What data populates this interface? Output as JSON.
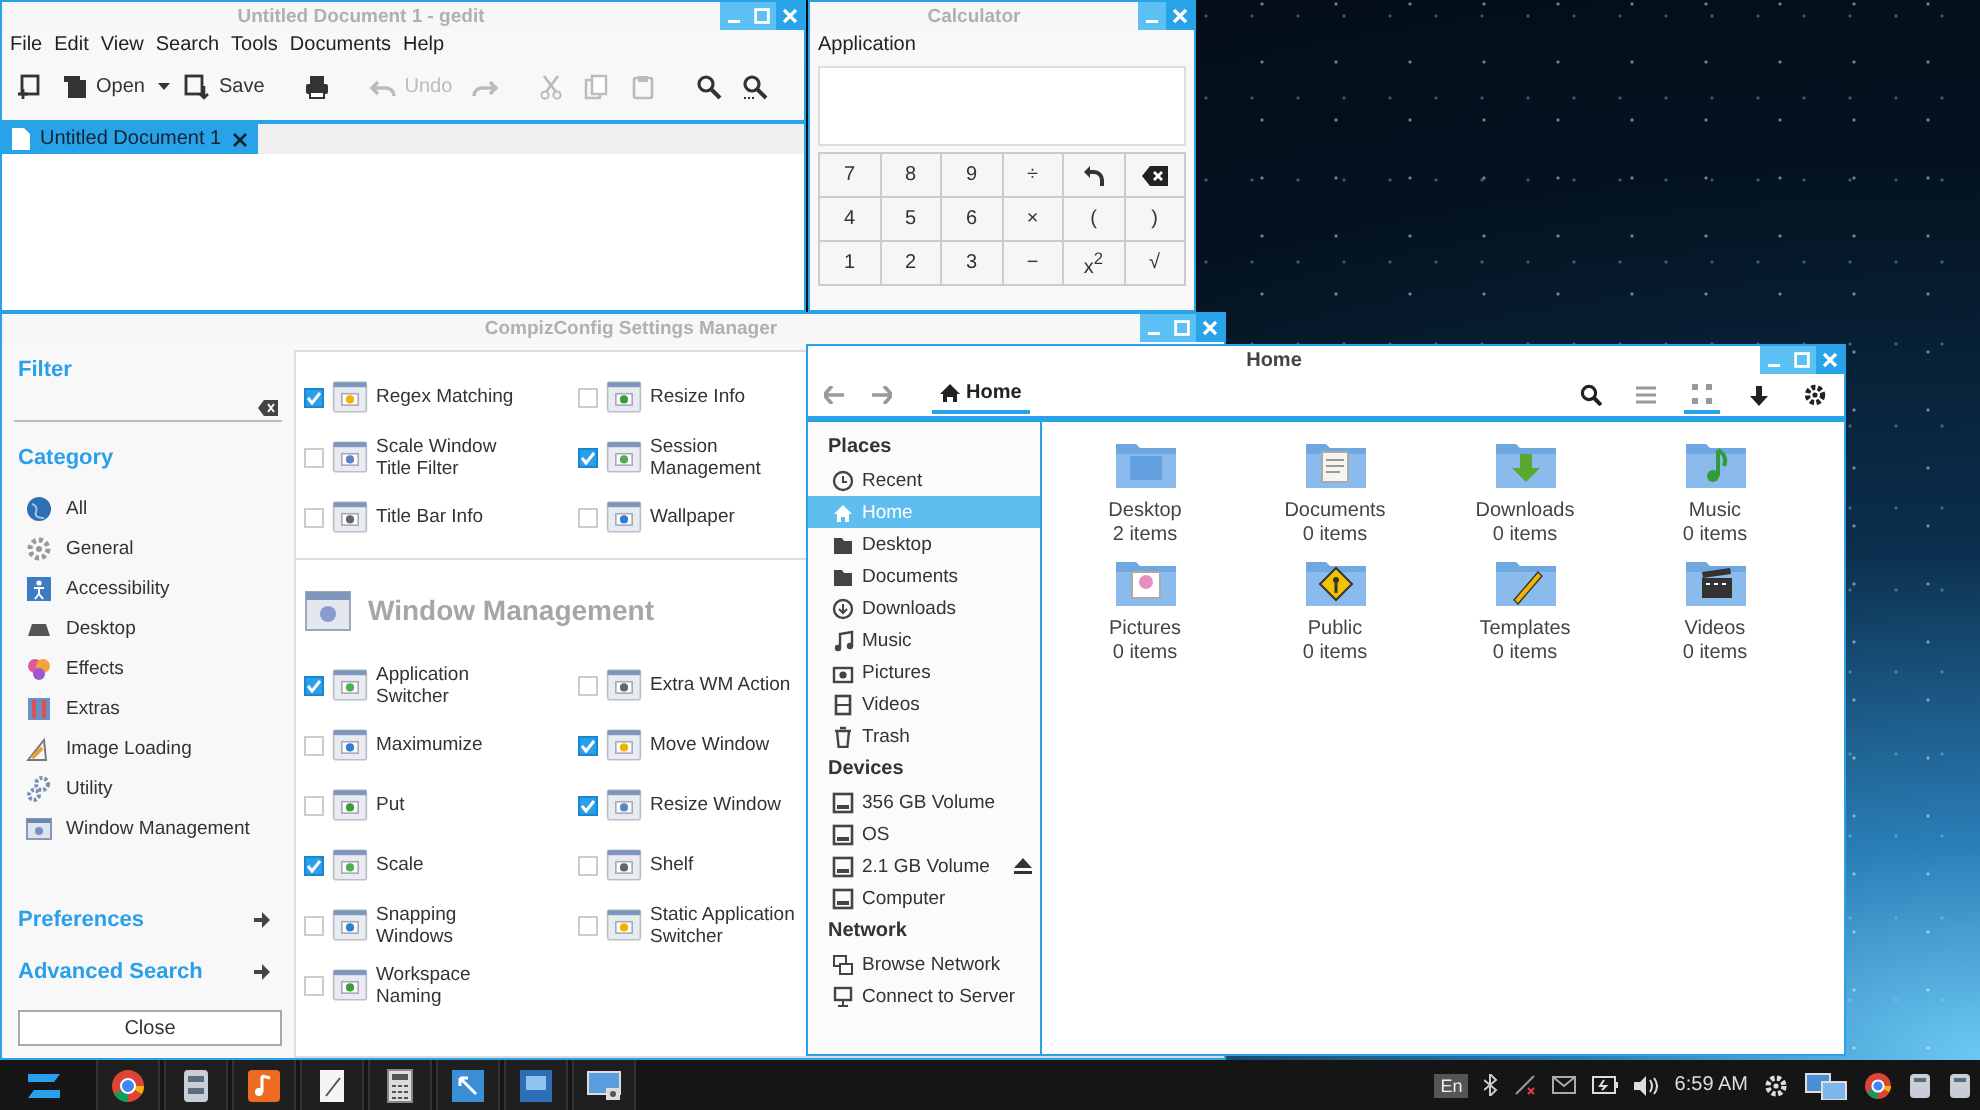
{
  "gedit": {
    "title": "Untitled Document 1 - gedit",
    "menu": [
      "File",
      "Edit",
      "View",
      "Search",
      "Tools",
      "Documents",
      "Help"
    ],
    "toolbar": [
      {
        "kind": "new",
        "disabled": false
      },
      {
        "kind": "open",
        "label": "Open",
        "disabled": false
      },
      {
        "kind": "save",
        "label": "Save",
        "disabled": false
      },
      {
        "kind": "print",
        "disabled": false
      },
      {
        "kind": "undo",
        "label": "Undo",
        "disabled": true
      },
      {
        "kind": "redo",
        "disabled": true
      },
      {
        "kind": "cut",
        "disabled": true
      },
      {
        "kind": "copy",
        "disabled": true
      },
      {
        "kind": "paste",
        "disabled": true
      },
      {
        "kind": "find",
        "disabled": false
      },
      {
        "kind": "replace",
        "disabled": false
      }
    ],
    "tabs": [
      {
        "label": "Untitled Document 1",
        "selected": true
      }
    ]
  },
  "calculator": {
    "title": "Calculator",
    "menu": [
      "Application"
    ],
    "keys": [
      [
        {
          "kind": "text",
          "label": "7"
        },
        {
          "kind": "text",
          "label": "8"
        },
        {
          "kind": "text",
          "label": "9"
        },
        {
          "kind": "text",
          "label": "÷"
        },
        {
          "kind": "undo"
        },
        {
          "kind": "backspace"
        }
      ],
      [
        {
          "kind": "text",
          "label": "4"
        },
        {
          "kind": "text",
          "label": "5"
        },
        {
          "kind": "text",
          "label": "6"
        },
        {
          "kind": "text",
          "label": "×"
        },
        {
          "kind": "text",
          "label": "("
        },
        {
          "kind": "text",
          "label": ")"
        }
      ],
      [
        {
          "kind": "text",
          "label": "1"
        },
        {
          "kind": "text",
          "label": "2"
        },
        {
          "kind": "text",
          "label": "3"
        },
        {
          "kind": "text",
          "label": "−"
        },
        {
          "kind": "text",
          "label": "x$^{2}$"
        },
        {
          "kind": "text",
          "label": "√"
        }
      ]
    ]
  },
  "compiz": {
    "title": "CompizConfig Settings Manager",
    "filter_heading": "Filter",
    "category_heading": "Category",
    "categories": [
      {
        "label": "All",
        "kind": "all"
      },
      {
        "label": "General",
        "kind": "general"
      },
      {
        "label": "Accessibility",
        "kind": "accessibility"
      },
      {
        "label": "Desktop",
        "kind": "desktop"
      },
      {
        "label": "Effects",
        "kind": "effects"
      },
      {
        "label": "Extras",
        "kind": "extras"
      },
      {
        "label": "Image Loading",
        "kind": "image"
      },
      {
        "label": "Utility",
        "kind": "utility"
      },
      {
        "label": "Window Management",
        "kind": "window"
      }
    ],
    "preferences": "Preferences",
    "advanced_search": "Advanced Search",
    "close": "Close",
    "sections": [
      {
        "plugins": [
          {
            "label": "Regex Matching",
            "checked": true
          },
          {
            "label": "Resize Info",
            "checked": false
          },
          {
            "label": "Scale Window Title Filter",
            "checked": false
          },
          {
            "label": "Session Management",
            "checked": true
          },
          {
            "label": "Title Bar Info",
            "checked": false
          },
          {
            "label": "Wallpaper",
            "checked": false
          }
        ]
      },
      {
        "heading": "Window Management",
        "plugins": [
          {
            "label": "Application Switcher",
            "checked": true
          },
          {
            "label": "Extra WM Action",
            "checked": false
          },
          {
            "label": "Maximumize",
            "checked": false
          },
          {
            "label": "Move Window",
            "checked": true
          },
          {
            "label": "Put",
            "checked": false
          },
          {
            "label": "Resize Window",
            "checked": true
          },
          {
            "label": "Scale",
            "checked": true
          },
          {
            "label": "Shelf",
            "checked": false
          },
          {
            "label": "Snapping Windows",
            "checked": false
          },
          {
            "label": "Static Application Switcher",
            "checked": false
          },
          {
            "label": "Workspace Naming",
            "checked": false
          }
        ]
      }
    ]
  },
  "files": {
    "title": "Home",
    "path": [
      {
        "label": "Home",
        "selected": true
      }
    ],
    "views": [
      {
        "kind": "list",
        "selected": false
      },
      {
        "kind": "grid",
        "selected": true
      }
    ],
    "sidebar": [
      {
        "heading": "Places",
        "items": [
          {
            "label": "Recent",
            "kind": "recent",
            "selected": false,
            "ejectable": false
          },
          {
            "label": "Home",
            "kind": "home",
            "selected": true,
            "ejectable": false
          },
          {
            "label": "Desktop",
            "kind": "folder",
            "selected": false,
            "ejectable": false
          },
          {
            "label": "Documents",
            "kind": "folder",
            "selected": false,
            "ejectable": false
          },
          {
            "label": "Downloads",
            "kind": "download",
            "selected": false,
            "ejectable": false
          },
          {
            "label": "Music",
            "kind": "music",
            "selected": false,
            "ejectable": false
          },
          {
            "label": "Pictures",
            "kind": "picture",
            "selected": false,
            "ejectable": false
          },
          {
            "label": "Videos",
            "kind": "video",
            "selected": false,
            "ejectable": false
          },
          {
            "label": "Trash",
            "kind": "trash",
            "selected": false,
            "ejectable": false
          }
        ]
      },
      {
        "heading": "Devices",
        "items": [
          {
            "label": "356 GB Volume",
            "kind": "drive",
            "selected": false,
            "ejectable": false
          },
          {
            "label": "OS",
            "kind": "drive",
            "selected": false,
            "ejectable": false
          },
          {
            "label": "2.1 GB Volume",
            "kind": "drive",
            "selected": false,
            "ejectable": true
          },
          {
            "label": "Computer",
            "kind": "drive",
            "selected": false,
            "ejectable": false
          }
        ]
      },
      {
        "heading": "Network",
        "items": [
          {
            "label": "Browse Network",
            "kind": "network",
            "selected": false,
            "ejectable": false
          },
          {
            "label": "Connect to Server",
            "kind": "server",
            "selected": false,
            "ejectable": false
          }
        ]
      }
    ],
    "items": [
      {
        "name": "Desktop",
        "count": "2 items",
        "kind": "desktop"
      },
      {
        "name": "Documents",
        "count": "0 items",
        "kind": "documents"
      },
      {
        "name": "Downloads",
        "count": "0 items",
        "kind": "downloads"
      },
      {
        "name": "Music",
        "count": "0 items",
        "kind": "music"
      },
      {
        "name": "Pictures",
        "count": "0 items",
        "kind": "pictures"
      },
      {
        "name": "Public",
        "count": "0 items",
        "kind": "public"
      },
      {
        "name": "Templates",
        "count": "0 items",
        "kind": "templates"
      },
      {
        "name": "Videos",
        "count": "0 items",
        "kind": "videos"
      }
    ]
  },
  "taskbar": {
    "apps": [
      {
        "kind": "browser"
      },
      {
        "kind": "files"
      },
      {
        "kind": "music"
      },
      {
        "kind": "editor"
      },
      {
        "kind": "calculator"
      },
      {
        "kind": "settings"
      },
      {
        "kind": "presentation"
      },
      {
        "kind": "screenshot"
      }
    ],
    "language": "En",
    "clock": "6:59 AM"
  }
}
